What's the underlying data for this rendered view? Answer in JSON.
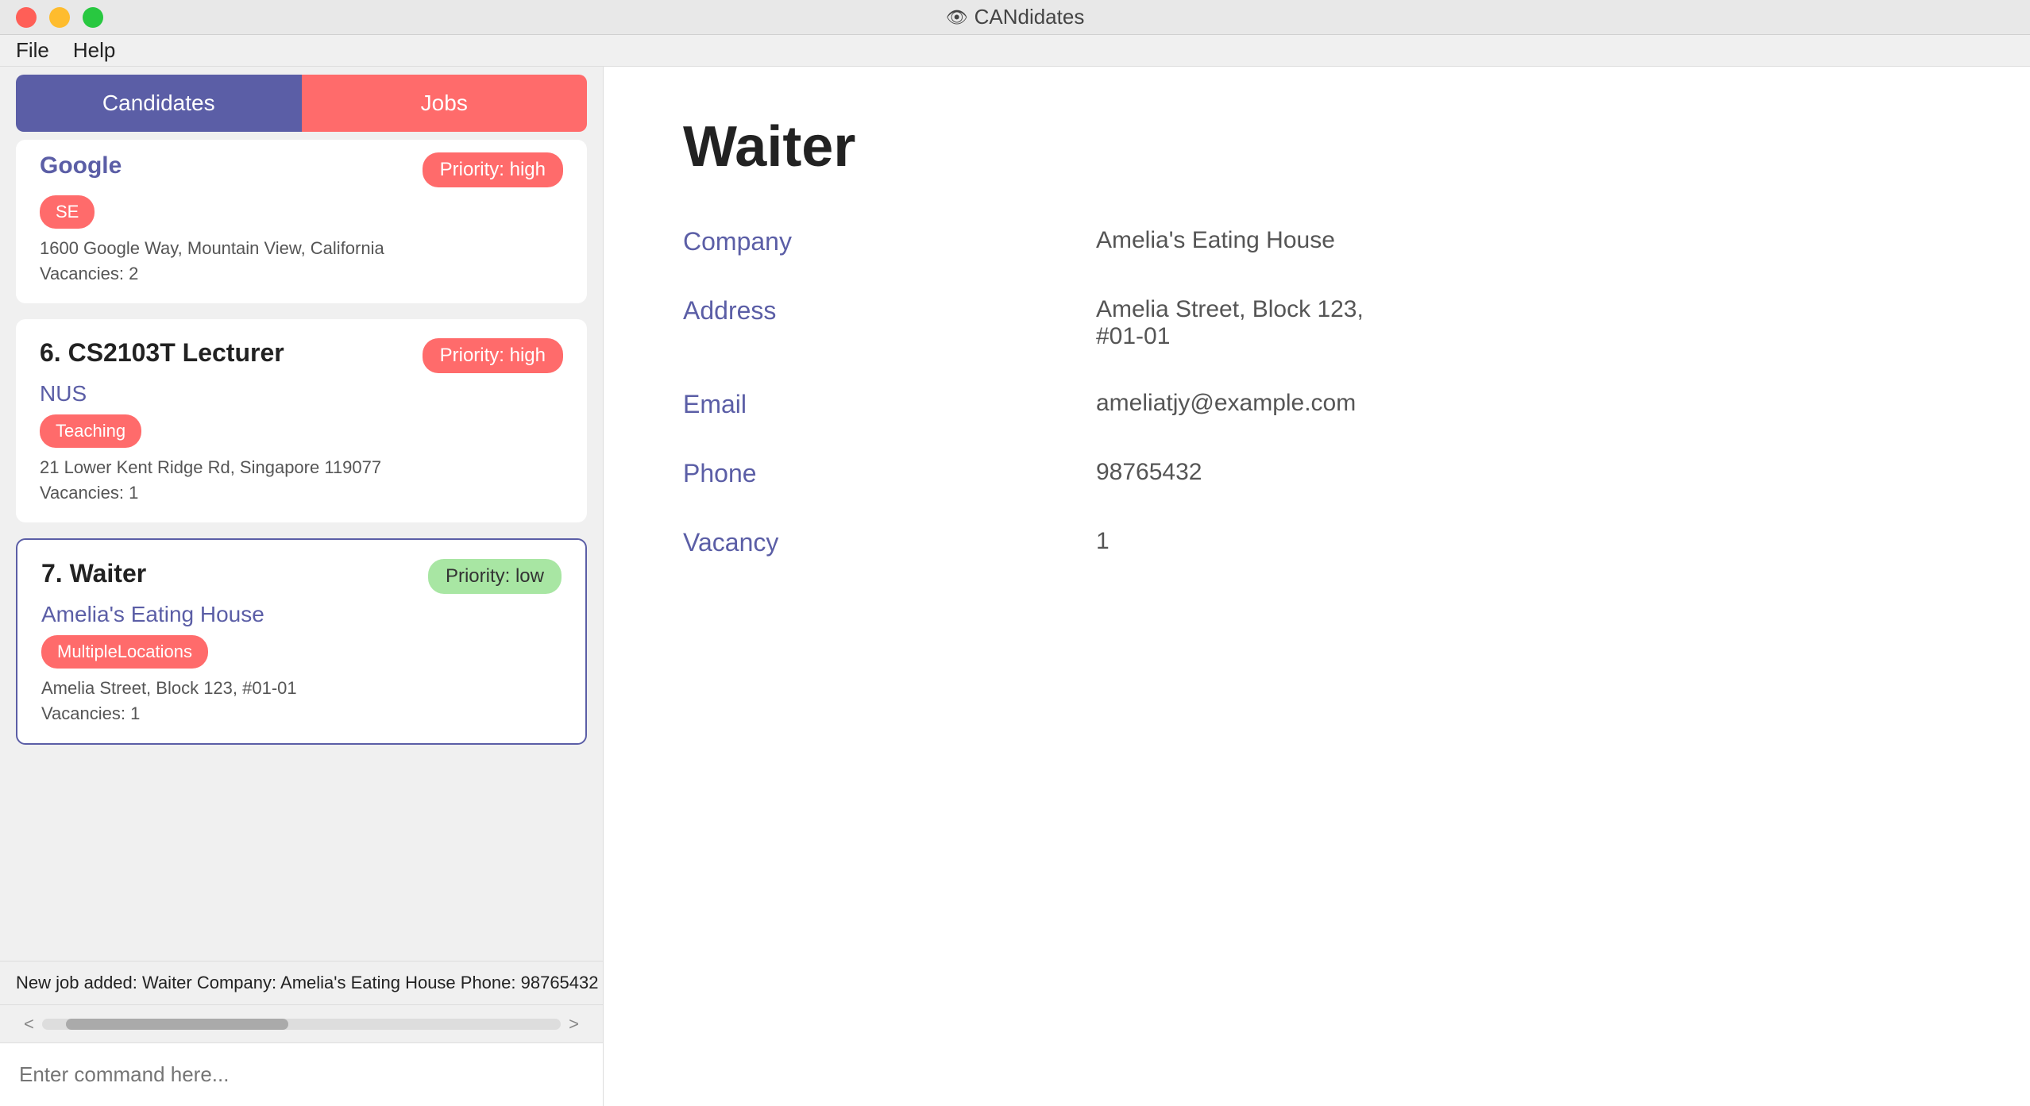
{
  "titlebar": {
    "title": "CANdidates",
    "icon": "👁"
  },
  "menubar": {
    "items": [
      "File",
      "Help"
    ]
  },
  "tabs": {
    "candidates": "Candidates",
    "jobs": "Jobs"
  },
  "jobs": [
    {
      "number": "",
      "title": "Google",
      "company": "Google",
      "tag": "SE",
      "tagClass": "tag-se",
      "priority": "Priority: high",
      "priorityClass": "priority-high",
      "address": "1600 Google Way, Mountain View, California",
      "vacancies": "Vacancies: 2",
      "partial": true
    },
    {
      "number": "6.",
      "title": "CS2103T Lecturer",
      "company": "NUS",
      "tag": "Teaching",
      "tagClass": "tag-teaching",
      "priority": "Priority: high",
      "priorityClass": "priority-high",
      "address": "21 Lower Kent Ridge Rd, Singapore 119077",
      "vacancies": "Vacancies: 1",
      "partial": false
    },
    {
      "number": "7.",
      "title": "Waiter",
      "company": "Amelia's Eating House",
      "tag": "MultipleLocations",
      "tagClass": "tag-multi",
      "priority": "Priority: low",
      "priorityClass": "priority-low",
      "address": "Amelia Street, Block 123, #01-01",
      "vacancies": "Vacancies: 1",
      "partial": false,
      "selected": true
    }
  ],
  "detail": {
    "title": "Waiter",
    "fields": [
      {
        "label": "Company",
        "value": "Amelia's Eating House"
      },
      {
        "label": "Address",
        "value": "Amelia Street, Block 123, #01-01"
      },
      {
        "label": "Email",
        "value": "ameliatjy@example.com"
      },
      {
        "label": "Phone",
        "value": "98765432"
      },
      {
        "label": "Vacancy",
        "value": "1"
      }
    ]
  },
  "status": {
    "message": "New job added: Waiter Company: Amelia's Eating House Phone: 98765432"
  },
  "command": {
    "placeholder": "Enter command here..."
  },
  "scrollbar": {
    "left_arrow": "<",
    "right_arrow": ">"
  }
}
